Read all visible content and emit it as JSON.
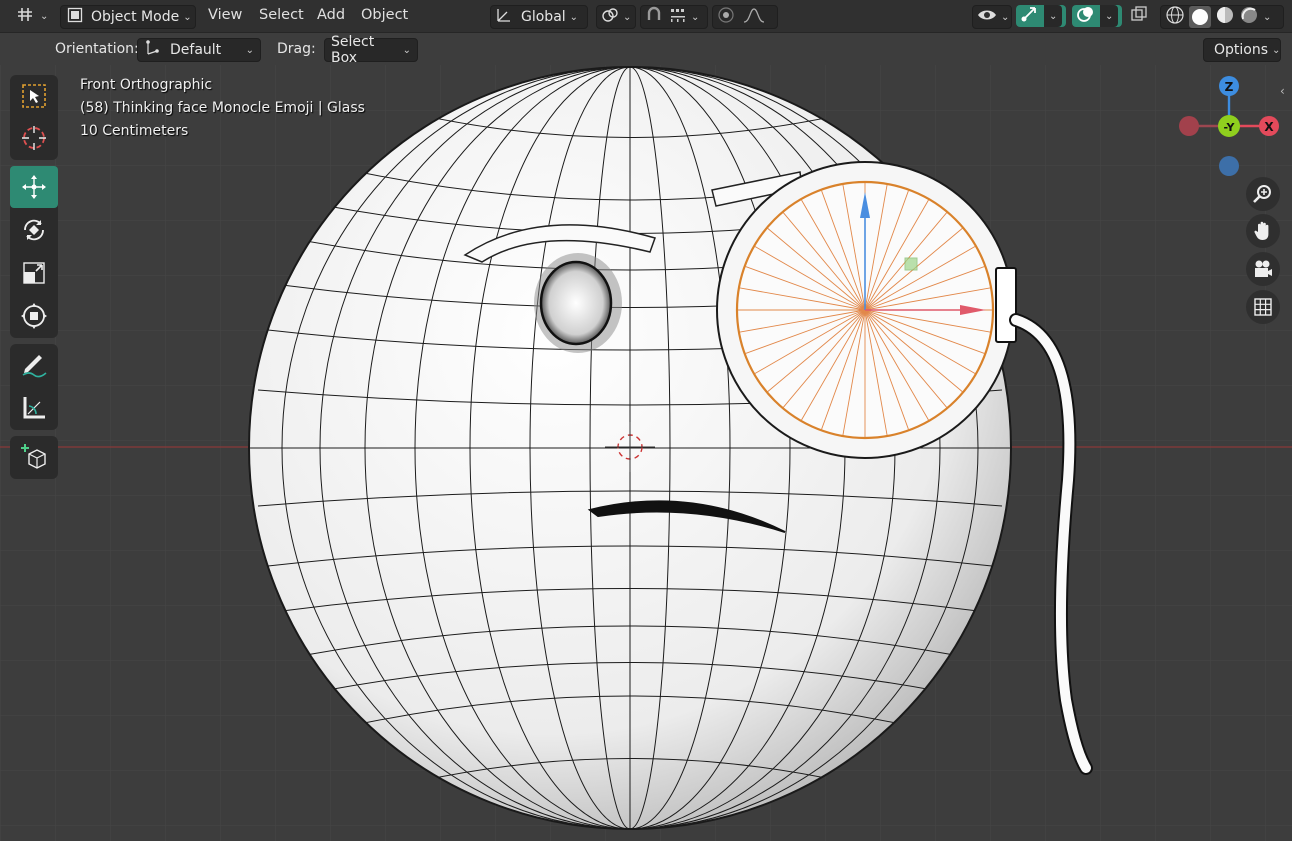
{
  "header": {
    "mode_label": "Object Mode",
    "menus": [
      "View",
      "Select",
      "Add",
      "Object"
    ],
    "transform_orientation": "Global",
    "options_label": "Options"
  },
  "tool_settings": {
    "orientation_label": "Orientation:",
    "orientation_value": "Default",
    "drag_label": "Drag:",
    "drag_value": "Select Box"
  },
  "viewport": {
    "view_name": "Front Orthographic",
    "object_info": "(58) Thinking face Monocle Emoji | Glass",
    "scale_info": "10 Centimeters"
  },
  "gizmo": {
    "z_label": "Z",
    "y_label": "-Y",
    "x_label": "X"
  },
  "colors": {
    "accent_active": "#2e8a73",
    "axis_x": "#e34a5b",
    "axis_y": "#8fcf1e",
    "axis_z": "#3d8de0"
  }
}
